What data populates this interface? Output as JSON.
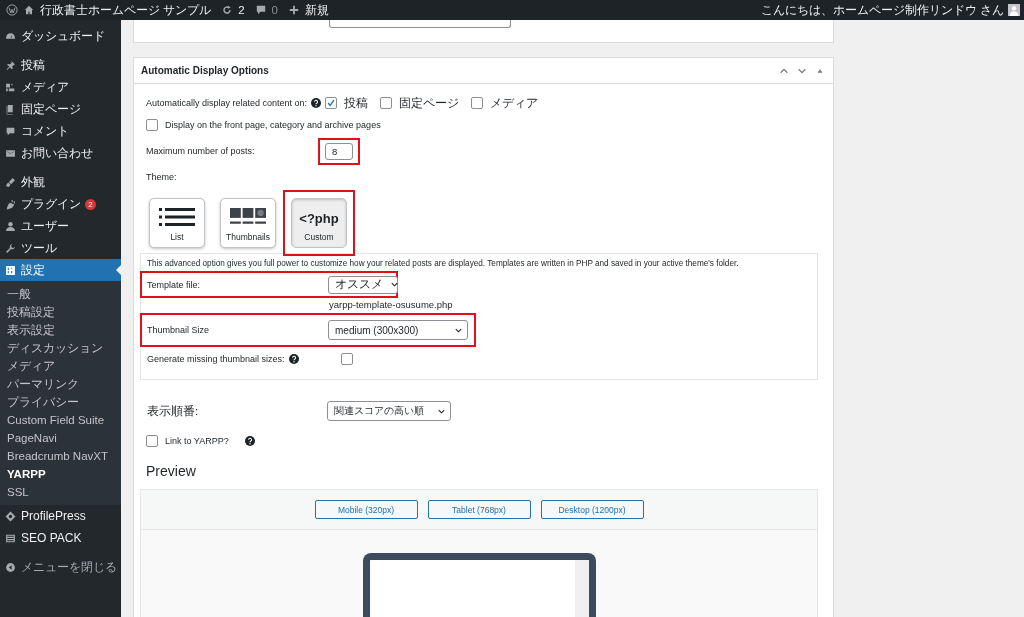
{
  "admin_bar": {
    "site_name": "行政書士ホームページ サンプル",
    "updates": "2",
    "comments": "0",
    "new": "新規",
    "greeting": "こんにちは、ホームページ制作リンドウ さん"
  },
  "sidebar": {
    "groups": [
      {
        "items": [
          {
            "label": "ダッシュボード",
            "selected": false
          }
        ]
      },
      {
        "items": [
          {
            "label": "投稿",
            "selected": false
          },
          {
            "label": "メディア",
            "selected": false
          },
          {
            "label": "固定ページ",
            "selected": false
          },
          {
            "label": "コメント",
            "selected": false
          },
          {
            "label": "お問い合わせ",
            "selected": false
          }
        ]
      },
      {
        "items": [
          {
            "label": "外観",
            "selected": false
          },
          {
            "label": "プラグイン",
            "selected": false,
            "badge": "2"
          },
          {
            "label": "ユーザー",
            "selected": false
          },
          {
            "label": "ツール",
            "selected": false
          },
          {
            "label": "設定",
            "selected": true,
            "expanded": true,
            "children": [
              {
                "label": "一般",
                "selected": false
              },
              {
                "label": "投稿設定",
                "selected": false
              },
              {
                "label": "表示設定",
                "selected": false
              },
              {
                "label": "ディスカッション",
                "selected": false
              },
              {
                "label": "メディア",
                "selected": false
              },
              {
                "label": "パーマリンク",
                "selected": false
              },
              {
                "label": "プライバシー",
                "selected": false
              },
              {
                "label": "Custom Field Suite",
                "selected": false
              },
              {
                "label": "PageNavi",
                "selected": false
              },
              {
                "label": "Breadcrumb NavXT",
                "selected": false
              },
              {
                "label": "YARPP",
                "selected": true
              },
              {
                "label": "SSL",
                "selected": false
              }
            ]
          },
          {
            "label": "ProfilePress",
            "selected": false
          },
          {
            "label": "SEO PACK",
            "selected": false
          }
        ]
      }
    ],
    "collapse": "メニューを閉じる"
  },
  "automatic_display": {
    "title": "Automatic Display Options",
    "display_on": {
      "label": "Automatically display related content on:",
      "options": [
        {
          "label": "投稿",
          "checked": true
        },
        {
          "label": "固定ページ",
          "checked": false
        },
        {
          "label": "メディア",
          "checked": false
        }
      ]
    },
    "front_page": {
      "label": "Display on the front page, category and archive pages",
      "checked": false
    },
    "max_posts": {
      "label": "Maximum number of posts:",
      "value": "8",
      "highlighted": true
    },
    "theme": {
      "label": "Theme:",
      "options": [
        {
          "kind": "list",
          "label": "List",
          "selected": false,
          "highlighted": false
        },
        {
          "kind": "thumbnails",
          "label": "Thumbnails",
          "selected": false,
          "highlighted": false
        },
        {
          "kind": "custom",
          "label": "Custom",
          "icon_text": "<?php",
          "selected": true,
          "highlighted": true
        }
      ]
    },
    "custom_options": {
      "description": "This advanced option gives you full power to customize how your related posts are displayed. Templates are written in PHP and saved in your active theme's folder.",
      "template_file": {
        "label": "Template file:",
        "value": "オススメ",
        "file": "yarpp-template-osusume.php",
        "highlighted": true
      },
      "thumbnail_size": {
        "label": "Thumbnail Size",
        "value": "medium (300x300)",
        "highlighted": true
      },
      "generate_missing": {
        "label": "Generate missing thumbnail sizes:",
        "checked": false
      }
    },
    "order": {
      "label": "表示順番:",
      "value": "関連スコアの高い順"
    },
    "link_to_yarpp": {
      "label": "Link to YARPP?",
      "checked": false
    },
    "preview": {
      "title": "Preview",
      "buttons": [
        "Mobile (320px)",
        "Tablet (768px)",
        "Desktop (1200px)"
      ]
    }
  }
}
